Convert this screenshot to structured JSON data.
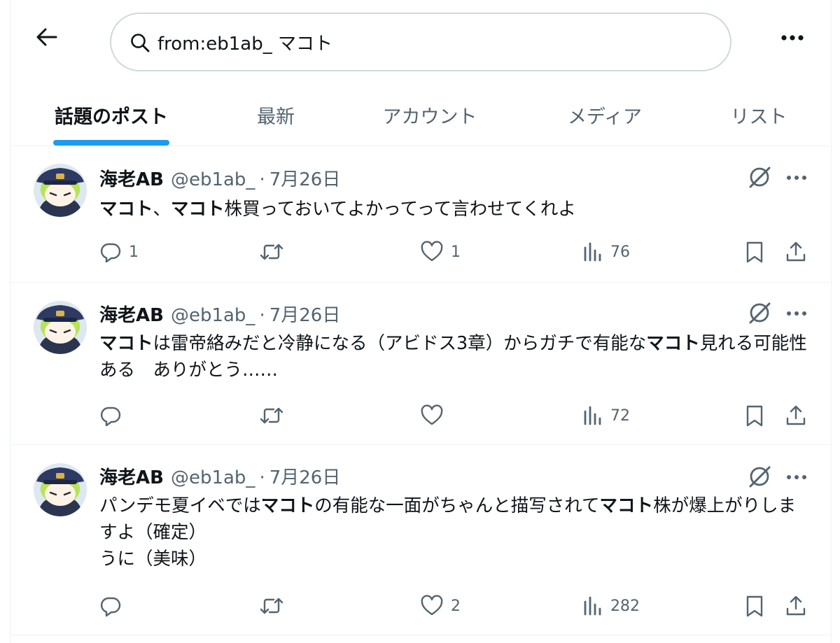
{
  "search": {
    "query": "from:eb1ab_ マコト"
  },
  "tabs": [
    {
      "label": "話題のポスト",
      "active": true
    },
    {
      "label": "最新",
      "active": false
    },
    {
      "label": "アカウント",
      "active": false
    },
    {
      "label": "メディア",
      "active": false
    },
    {
      "label": "リスト",
      "active": false
    }
  ],
  "colors": {
    "accent": "#1d9bf0",
    "text_primary": "#0f1419",
    "text_secondary": "#536471",
    "border": "#eff3f4"
  },
  "posts": [
    {
      "author_name": "海老AB",
      "author_handle": "@eb1ab_",
      "separator": "·",
      "date": "7月26日",
      "text_segments": [
        {
          "text": "マコト",
          "bold": true
        },
        {
          "text": "、",
          "bold": false
        },
        {
          "text": "マコト",
          "bold": true
        },
        {
          "text": "株買っておいてよかってって言わせてくれよ",
          "bold": false
        }
      ],
      "replies": "1",
      "reposts": "",
      "likes": "1",
      "views": "76"
    },
    {
      "author_name": "海老AB",
      "author_handle": "@eb1ab_",
      "separator": "·",
      "date": "7月26日",
      "text_segments": [
        {
          "text": "マコト",
          "bold": true
        },
        {
          "text": "は雷帝絡みだと冷静になる（アビドス3章）からガチで有能な",
          "bold": false
        },
        {
          "text": "マコト",
          "bold": true
        },
        {
          "text": "見れる可能性ある　ありがとう……",
          "bold": false
        }
      ],
      "replies": "",
      "reposts": "",
      "likes": "",
      "views": "72"
    },
    {
      "author_name": "海老AB",
      "author_handle": "@eb1ab_",
      "separator": "·",
      "date": "7月26日",
      "text_segments": [
        {
          "text": "パンデモ夏イベでは",
          "bold": false
        },
        {
          "text": "マコト",
          "bold": true
        },
        {
          "text": "の有能な一面がちゃんと描写されて",
          "bold": false
        },
        {
          "text": "マコト",
          "bold": true
        },
        {
          "text": "株が爆上がりしますよ（確定）\nうに（美味）",
          "bold": false
        }
      ],
      "replies": "",
      "reposts": "",
      "likes": "2",
      "views": "282"
    }
  ]
}
